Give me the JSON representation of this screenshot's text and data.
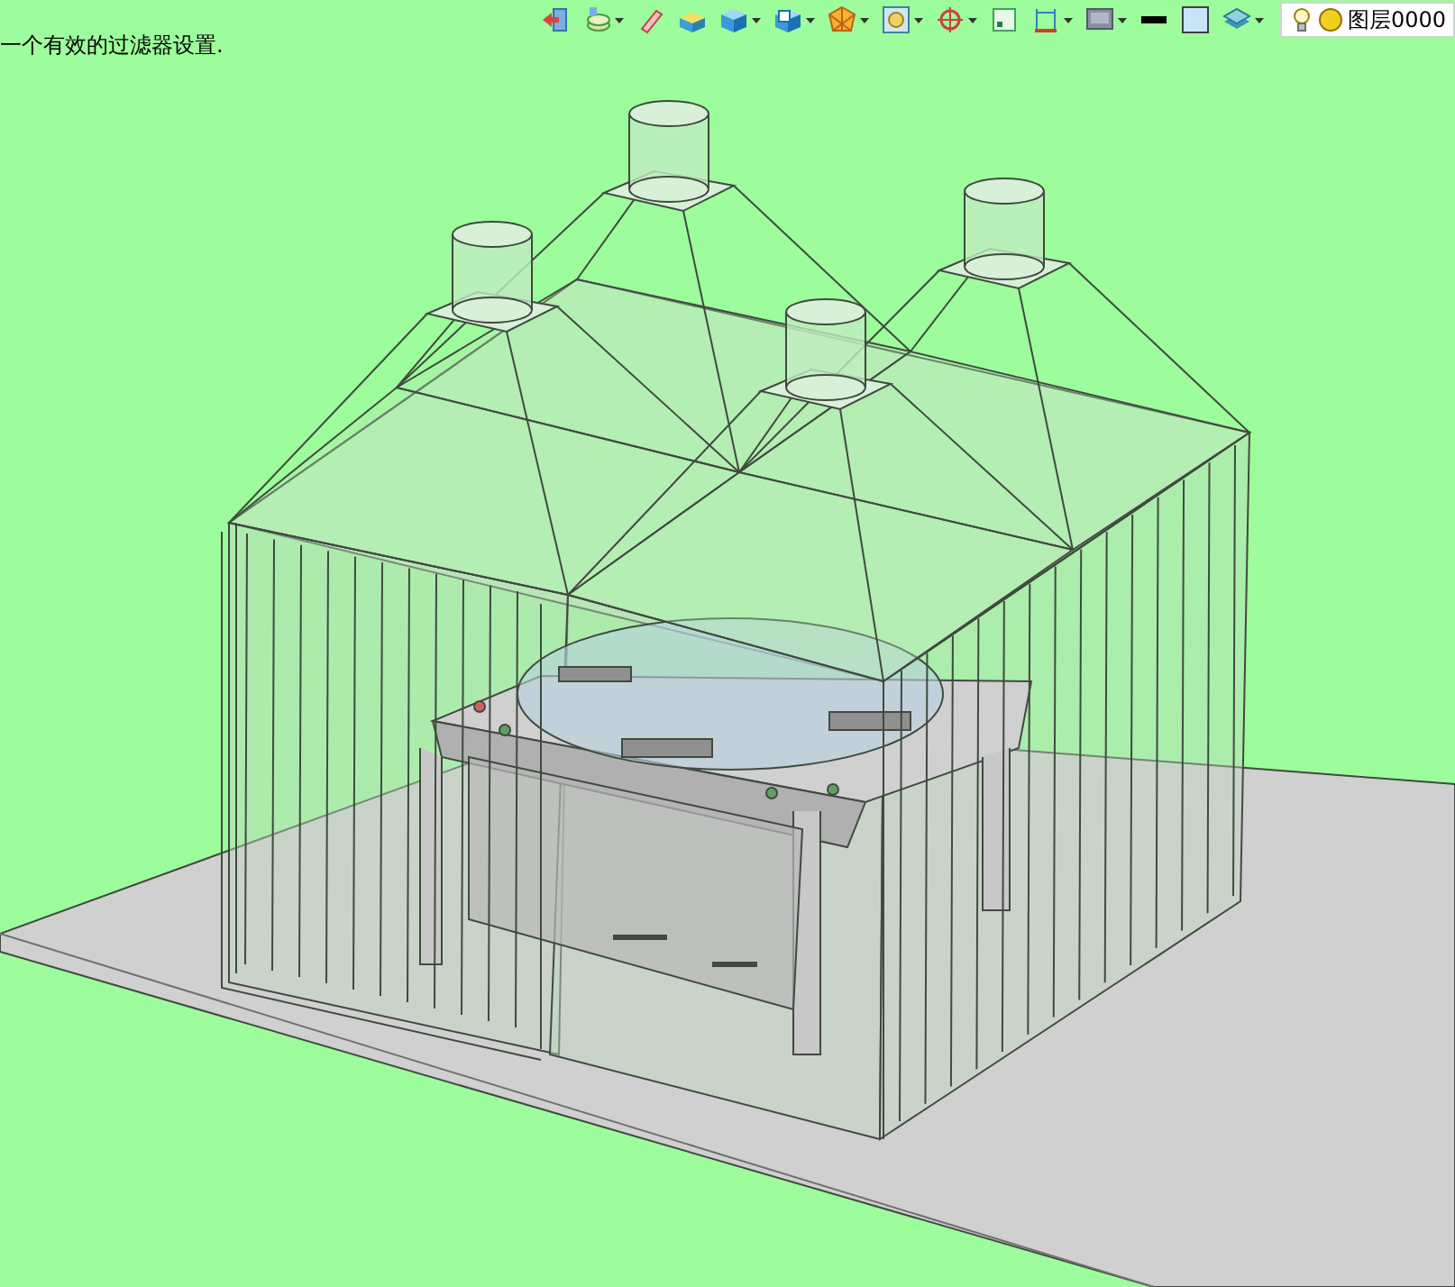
{
  "status_text": "一个有效的过滤器设置.",
  "toolbar": [
    {
      "kind": "exit",
      "dropdown": false
    },
    {
      "kind": "layers",
      "dropdown": true
    },
    {
      "kind": "pencil",
      "dropdown": false
    },
    {
      "kind": "box",
      "dropdown": false
    },
    {
      "kind": "cube",
      "dropdown": true
    },
    {
      "kind": "screen-cube",
      "dropdown": true
    },
    {
      "kind": "polygon",
      "dropdown": true
    },
    {
      "kind": "frame",
      "dropdown": true
    },
    {
      "kind": "target",
      "dropdown": true
    },
    {
      "kind": "square",
      "dropdown": false
    },
    {
      "kind": "dimension",
      "dropdown": true
    },
    {
      "kind": "monitor",
      "dropdown": true
    },
    {
      "kind": "line",
      "dropdown": false
    },
    {
      "kind": "swatch",
      "dropdown": false
    },
    {
      "kind": "stack",
      "dropdown": true
    }
  ],
  "layer_selector": {
    "label": "图层0000"
  }
}
